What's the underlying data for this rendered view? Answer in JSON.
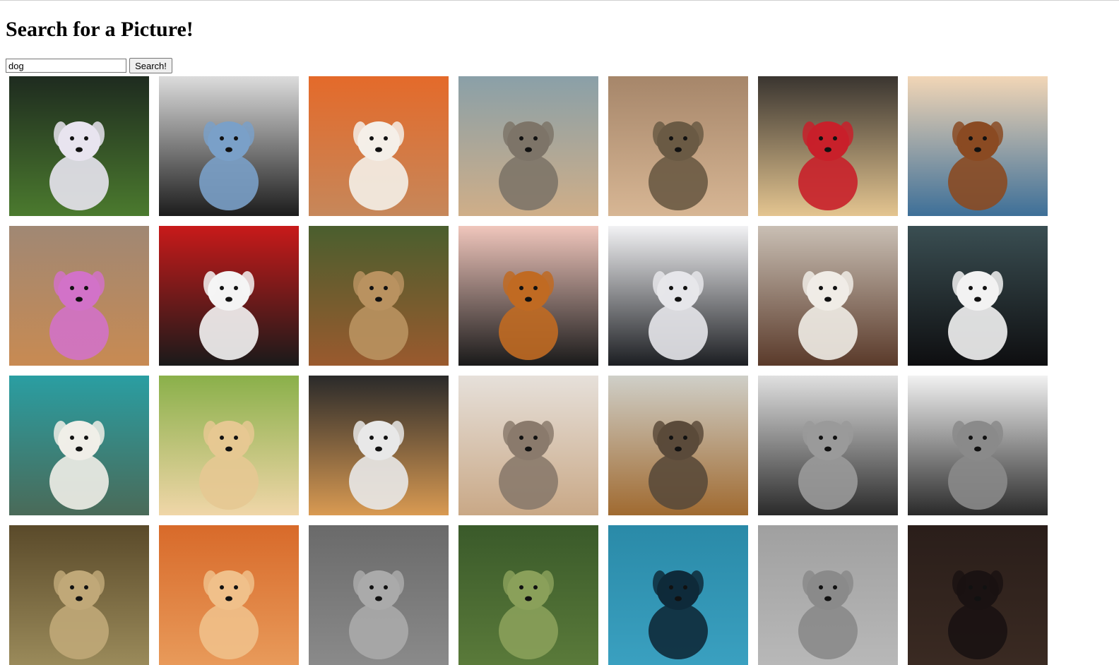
{
  "page": {
    "title": "Search for a Picture!"
  },
  "search": {
    "value": "dog",
    "button_label": "Search!"
  },
  "results": [
    {
      "name": "white-poodle-running-on-grass",
      "colors": [
        "#1e2b1f",
        "#4b7a2e",
        "#e8e4ef"
      ]
    },
    {
      "name": "black-pug-in-denim-jacket",
      "colors": [
        "#dcdcdc",
        "#1c1c1c",
        "#7aa0c8"
      ]
    },
    {
      "name": "corgi-on-orange-background",
      "colors": [
        "#e46a2a",
        "#c6875a",
        "#f4efe8"
      ]
    },
    {
      "name": "puppy-with-flower-in-mouth",
      "colors": [
        "#8aa0a8",
        "#cfae88",
        "#7d7468"
      ]
    },
    {
      "name": "corgi-and-terrier-walking",
      "colors": [
        "#a6866a",
        "#d7b694",
        "#6a5a44"
      ]
    },
    {
      "name": "golden-puppy-red-collar",
      "colors": [
        "#3a3530",
        "#e4c590",
        "#c8202a"
      ]
    },
    {
      "name": "dog-running-in-sea-waves",
      "colors": [
        "#f2d6b6",
        "#3d6f98",
        "#8a4a22"
      ]
    },
    {
      "name": "golden-retriever-pink-flower",
      "colors": [
        "#a08874",
        "#c88a52",
        "#d272c8"
      ]
    },
    {
      "name": "black-pug-on-red",
      "colors": [
        "#c81a1a",
        "#1a1a1a",
        "#f4f4f4"
      ]
    },
    {
      "name": "brown-dog-in-tall-grass",
      "colors": [
        "#4a5e2e",
        "#9a5a2e",
        "#b99260"
      ]
    },
    {
      "name": "tricolor-dog-pink-wall",
      "colors": [
        "#f0c6bc",
        "#1a1a1a",
        "#c06a22"
      ]
    },
    {
      "name": "black-labrador-white-room",
      "colors": [
        "#f2f2f4",
        "#1c1e22",
        "#e6e6ea"
      ]
    },
    {
      "name": "aussie-dog-running-on-sand",
      "colors": [
        "#c9bfb4",
        "#5a3a2a",
        "#f0ece6"
      ]
    },
    {
      "name": "border-collie-smiling",
      "colors": [
        "#3a4e52",
        "#0e0e10",
        "#f2f2f2"
      ]
    },
    {
      "name": "white-dog-by-mountain-lake",
      "colors": [
        "#2a9ea2",
        "#4a6a58",
        "#f0eee8"
      ]
    },
    {
      "name": "golden-retriever-in-field",
      "colors": [
        "#8ab04a",
        "#f0d6a8",
        "#e6c892"
      ]
    },
    {
      "name": "fluffy-dog-with-sunglasses",
      "colors": [
        "#2a2a2a",
        "#d99a52",
        "#e8e8e8"
      ]
    },
    {
      "name": "pug-on-couch",
      "colors": [
        "#e6e0da",
        "#c9a886",
        "#8a7a6c"
      ]
    },
    {
      "name": "dog-on-sofa-by-window",
      "colors": [
        "#cfcfc8",
        "#a06a30",
        "#5a4a3a"
      ]
    },
    {
      "name": "black-and-white-pug",
      "colors": [
        "#e0e0e0",
        "#2a2a2a",
        "#9a9a9a"
      ]
    },
    {
      "name": "black-and-white-lab",
      "colors": [
        "#f2f2f2",
        "#2a2a2a",
        "#8a8a8a"
      ]
    },
    {
      "name": "partial-row-image-1",
      "colors": [
        "#5a4a2a",
        "#9a8a5a",
        "#c0a878"
      ]
    },
    {
      "name": "partial-row-image-2",
      "colors": [
        "#d86a2a",
        "#e89a5a",
        "#f0c08a"
      ]
    },
    {
      "name": "partial-row-image-3",
      "colors": [
        "#6a6a6a",
        "#8a8a8a",
        "#aaaaaa"
      ]
    },
    {
      "name": "partial-row-image-4",
      "colors": [
        "#3a5a2a",
        "#5a7a3a",
        "#8aa05a"
      ]
    },
    {
      "name": "partial-row-image-5",
      "colors": [
        "#2a8aa8",
        "#3aa0c0",
        "#0e2a3a"
      ]
    },
    {
      "name": "partial-row-image-6",
      "colors": [
        "#a0a0a0",
        "#b8b8b8",
        "#8a8a8a"
      ]
    },
    {
      "name": "partial-row-image-7",
      "colors": [
        "#2a1e1a",
        "#3a2a22",
        "#1a1212"
      ]
    }
  ]
}
